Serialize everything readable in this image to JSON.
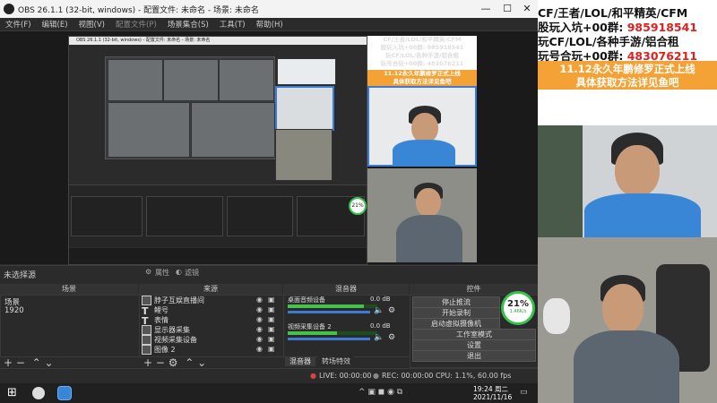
{
  "window": {
    "title": "OBS 26.1.1 (32-bit, windows) - 配置文件: 未命名 - 场景: 未命名",
    "min": "—",
    "max": "☐",
    "close": "✕"
  },
  "menu": [
    "文件(F)",
    "编辑(E)",
    "视图(V)",
    "配置文件(P)",
    "场景集合(S)",
    "工具(T)",
    "帮助(H)"
  ],
  "nested_preview": {
    "title": "OBS 26.1.1 (32-bit, windows) - 配置文件: 未命名 - 场景: 未命名"
  },
  "banner_small": {
    "line1": "CF/王者/LOL/和平精英/CFM",
    "line2": "股玩入坑+00群: 985918541",
    "line3": "玩CF/LOL/各种手游/铝合租",
    "line4": "玩号合玩+00群: 483076211",
    "promo1": "11.12永久年鹏修罗正式上线",
    "promo2": "具体获取方法详见鱼吧"
  },
  "info_row": {
    "no_source": "未选择源",
    "properties": "属性",
    "filters": "滤镜"
  },
  "docks": {
    "scenes": "场景",
    "sources": "来源",
    "mixer": "混音器",
    "controls": "控件"
  },
  "scenes": [
    "场景",
    "1920"
  ],
  "sources": [
    {
      "label": "脖子互娱直播间"
    },
    {
      "label": "鲤号"
    },
    {
      "label": "表情"
    },
    {
      "label": "显示器采集"
    },
    {
      "label": "视频采集设备"
    },
    {
      "label": "图像 2"
    }
  ],
  "mixer": {
    "track1": {
      "name": "桌面音频设备",
      "db": "0.0 dB",
      "level": 0.85
    },
    "track2": {
      "name": "视频采集设备 2",
      "db": "0.0 dB",
      "level": 0.55
    },
    "tab_mixer": "混音器",
    "tab_transitions": "转场特效"
  },
  "controls": [
    "停止推流",
    "开始录制",
    "启动虚拟摄像机",
    "工作室模式",
    "设置",
    "退出"
  ],
  "gauge": {
    "value": "21%",
    "sub": "1.46K/s"
  },
  "gauge_small": {
    "value": "21%"
  },
  "status": {
    "live": "LIVE: 00:00:00",
    "rec": "REC: 00:00:00",
    "cpu": "CPU: 1.1%, 60.00 fps"
  },
  "taskbar": {
    "time": "19:24 周二",
    "date": "2021/11/16"
  },
  "right_panel": {
    "line1": "CF/王者/LOL/和平精英/CFM",
    "line2a": "股玩入坑+00群: ",
    "line2b": "985918541",
    "line3": "玩CF/LOL/各种手游/铝合租",
    "line4a": "玩号合玩+00群: ",
    "line4b": "483076211",
    "promo1": "11.12永久年鹏修罗正式上线",
    "promo2": "具体获取方法详见鱼吧"
  },
  "colors": {
    "accent": "#3b7bd6",
    "promo_orange": "#f4a235",
    "red": "#e02020",
    "green": "#36c24a"
  }
}
